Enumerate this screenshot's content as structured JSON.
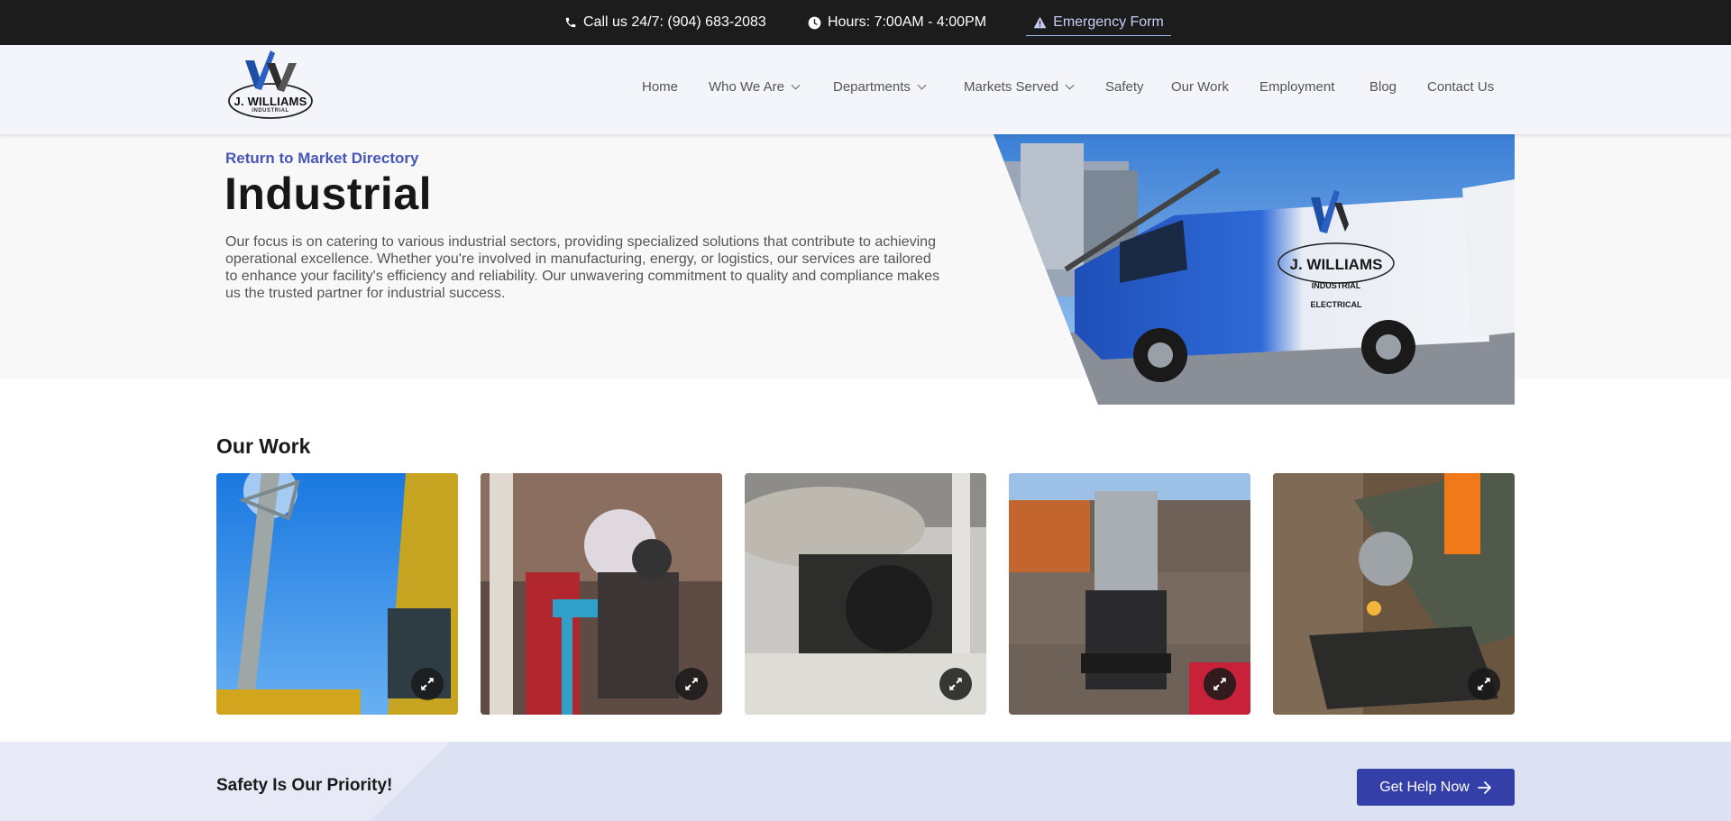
{
  "topbar": {
    "phone": "Call us 24/7: (904) 683-2083",
    "hours": "Hours: 7:00AM - 4:00PM",
    "emergency": "Emergency Form"
  },
  "logo": {
    "name": "J. WILLIAMS",
    "sub": "INDUSTRIAL"
  },
  "nav": {
    "items": [
      {
        "label": "Home"
      },
      {
        "label": "Who We Are"
      },
      {
        "label": "Departments"
      },
      {
        "label": "Markets Served"
      },
      {
        "label": "Safety"
      },
      {
        "label": "Our Work"
      },
      {
        "label": "Employment"
      },
      {
        "label": "Blog"
      },
      {
        "label": "Contact Us"
      }
    ]
  },
  "hero": {
    "return_link": "Return to Market Directory",
    "title": "Industrial",
    "description": "Our focus is on catering to various industrial sectors, providing specialized solutions that contribute to achieving operational excellence. Whether you're involved in manufacturing, energy, or logistics, our services are tailored to enhance your facility's efficiency and reliability. Our unwavering commitment to quality and compliance makes us the trusted partner for industrial success.",
    "van_lines": [
      "J. WILLIAMS",
      "INDUSTRIAL",
      "ELECTRICAL"
    ]
  },
  "work": {
    "title": "Our Work"
  },
  "safety": {
    "title": "Safety Is Our Priority!",
    "button": "Get Help Now"
  },
  "colors": {
    "accent": "#3440a8",
    "link": "#4756b9",
    "topbar": "#1c1c1c"
  }
}
